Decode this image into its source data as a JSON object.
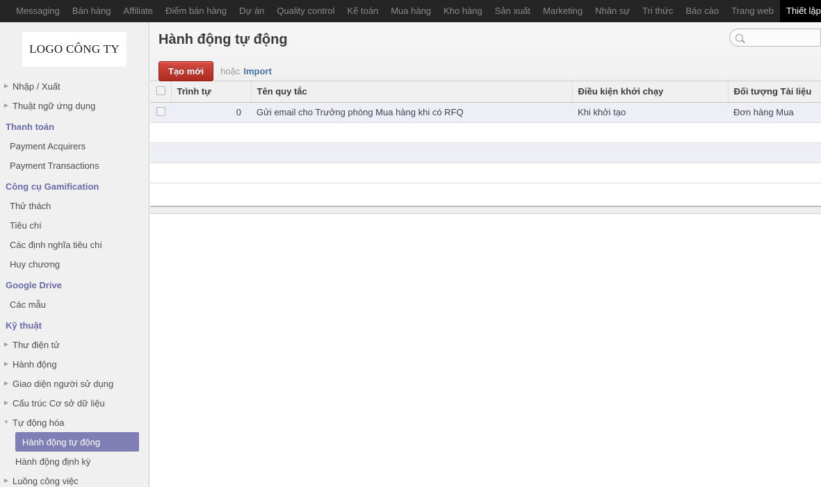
{
  "topnav": {
    "items": [
      {
        "label": "Messaging",
        "active": false
      },
      {
        "label": "Bán hàng",
        "active": false
      },
      {
        "label": "Affiliate",
        "active": false
      },
      {
        "label": "Điểm bán hàng",
        "active": false
      },
      {
        "label": "Dự án",
        "active": false
      },
      {
        "label": "Quality control",
        "active": false
      },
      {
        "label": "Kế toán",
        "active": false
      },
      {
        "label": "Mua hàng",
        "active": false
      },
      {
        "label": "Kho hàng",
        "active": false
      },
      {
        "label": "Sản xuất",
        "active": false
      },
      {
        "label": "Marketing",
        "active": false
      },
      {
        "label": "Nhân sự",
        "active": false
      },
      {
        "label": "Tri thức",
        "active": false
      },
      {
        "label": "Báo cáo",
        "active": false
      },
      {
        "label": "Trang web",
        "active": false
      },
      {
        "label": "Thiết lập",
        "active": true
      }
    ]
  },
  "sidebar": {
    "logo_text": "LOGO CÔNG TY",
    "scroll_up_icon": "▲",
    "blocks": [
      {
        "type": "toggle",
        "label": "Nhập / Xuất",
        "expanded": false,
        "icon": "triangle-right-icon"
      },
      {
        "type": "toggle",
        "label": "Thuật ngữ ứng dụng",
        "expanded": false,
        "icon": "triangle-right-icon"
      },
      {
        "type": "section",
        "label": "Thanh toán"
      },
      {
        "type": "leaf",
        "label": "Payment Acquirers"
      },
      {
        "type": "leaf",
        "label": "Payment Transactions"
      },
      {
        "type": "section",
        "label": "Công cụ Gamification"
      },
      {
        "type": "leaf",
        "label": "Thử thách"
      },
      {
        "type": "leaf",
        "label": "Tiêu chí"
      },
      {
        "type": "leaf",
        "label": "Các định nghĩa tiêu chí"
      },
      {
        "type": "leaf",
        "label": "Huy chương"
      },
      {
        "type": "section",
        "label": "Google Drive"
      },
      {
        "type": "leaf",
        "label": "Các mẫu"
      },
      {
        "type": "section",
        "label": "Kỹ thuật"
      },
      {
        "type": "toggle",
        "label": "Thư điện tử",
        "expanded": false,
        "icon": "triangle-right-icon"
      },
      {
        "type": "toggle",
        "label": "Hành động",
        "expanded": false,
        "icon": "triangle-right-icon"
      },
      {
        "type": "toggle",
        "label": "Giao diện người sử dụng",
        "expanded": false,
        "icon": "triangle-right-icon"
      },
      {
        "type": "toggle",
        "label": "Cấu trúc Cơ sở dữ liệu",
        "expanded": false,
        "icon": "triangle-right-icon"
      },
      {
        "type": "toggle",
        "label": "Tự động hóa",
        "expanded": true,
        "icon": "triangle-down-icon"
      },
      {
        "type": "child-selected",
        "label": "Hành động tự động"
      },
      {
        "type": "child",
        "label": "Hành động định kỳ"
      },
      {
        "type": "toggle",
        "label": "Luồng công việc",
        "expanded": false,
        "icon": "triangle-right-icon"
      }
    ],
    "selected_item": "Hành động tự động",
    "section_color": "#6a6aa8",
    "selected_bg": "#7f7fb5"
  },
  "main": {
    "page_title": "Hành động tự động",
    "create_button_label": "Tạo mới",
    "or_text": "hoặc",
    "import_link_label": "Import",
    "create_button_color": "#ab2a20",
    "search": {
      "icon": "search-icon",
      "value": "",
      "placeholder": ""
    },
    "table": {
      "columns": [
        {
          "key": "checkbox",
          "label": ""
        },
        {
          "key": "sequence",
          "label": "Trình tự"
        },
        {
          "key": "rule_name",
          "label": "Tên quy tắc"
        },
        {
          "key": "trigger_condition",
          "label": "Điều kiện khởi chạy"
        },
        {
          "key": "document_object",
          "label": "Đối tượng Tài liệu"
        }
      ],
      "rows": [
        {
          "sequence": "0",
          "rule_name": "Gửi email cho Trưởng phòng Mua hàng khi có RFQ",
          "trigger_condition": "Khi khởi tạo",
          "document_object": "Đơn hàng Mua"
        },
        {
          "sequence": "",
          "rule_name": "",
          "trigger_condition": "",
          "document_object": ""
        },
        {
          "sequence": "",
          "rule_name": "",
          "trigger_condition": "",
          "document_object": ""
        },
        {
          "sequence": "",
          "rule_name": "",
          "trigger_condition": "",
          "document_object": ""
        }
      ]
    }
  }
}
